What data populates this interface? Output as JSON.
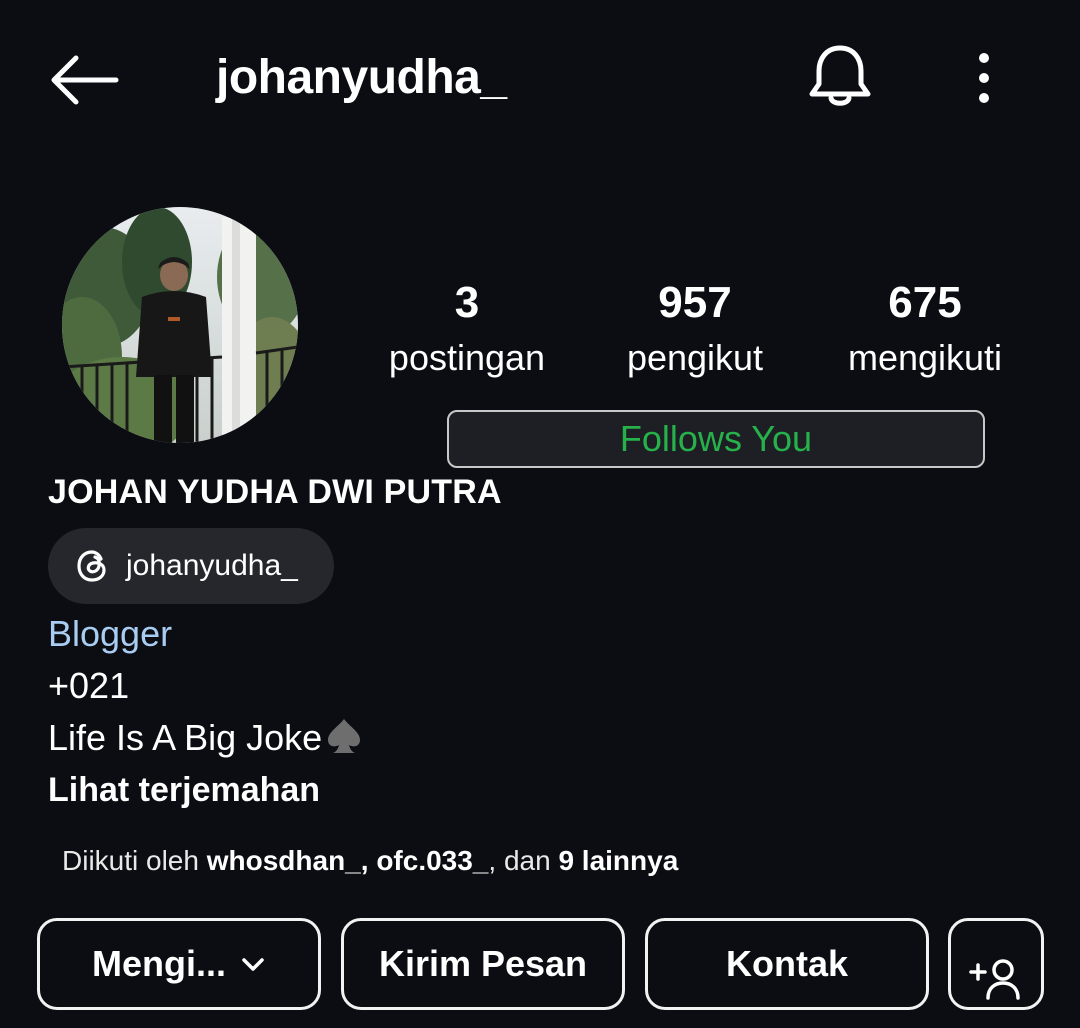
{
  "header": {
    "username": "johanyudha_",
    "back_icon": "arrow-left-icon",
    "bell_icon": "bell-icon",
    "more_icon": "more-vertical-icon"
  },
  "profile": {
    "avatar_icon": "profile-photo",
    "stats": {
      "posts_count": "3",
      "posts_label": "postingan",
      "followers_count": "957",
      "followers_label": "pengikut",
      "following_count": "675",
      "following_label": "mengikuti"
    },
    "follows_you_label": "Follows You",
    "full_name": "JOHAN YUDHA DWI PUTRA",
    "threads_handle": "johanyudha_",
    "bio": {
      "category": "Blogger",
      "phone": "+021",
      "tagline": "Life Is A Big Joke"
    },
    "translate_label": "Lihat terjemahan",
    "followed_by": {
      "prefix": "Diikuti oleh",
      "user1": "whosdhan_",
      "separator": ",",
      "user2": "ofc.033_",
      "conjunction": ", dan",
      "others": "9 lainnya"
    }
  },
  "actions": {
    "following_label": "Mengi...",
    "message_label": "Kirim Pesan",
    "contact_label": "Kontak"
  },
  "colors": {
    "background": "#0c0d12",
    "follows_you_text": "#27b14a",
    "category_text": "#a9ccf2",
    "chip_background": "#25272c"
  }
}
